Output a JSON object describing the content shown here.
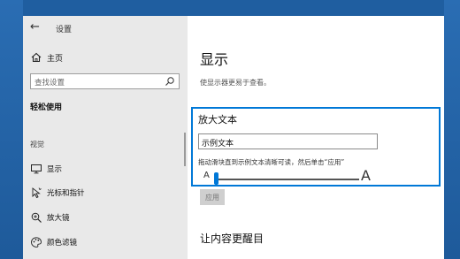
{
  "window": {
    "title": "设置"
  },
  "sidebar": {
    "home_label": "主页",
    "search_placeholder": "查找设置",
    "section_heading": "轻松使用",
    "group_label": "视觉",
    "items": [
      {
        "label": "显示",
        "icon": "monitor-icon",
        "selected": true
      },
      {
        "label": "光标和指针",
        "icon": "cursor-icon",
        "selected": false
      },
      {
        "label": "放大镜",
        "icon": "magnifier-icon",
        "selected": false
      },
      {
        "label": "颜色滤镜",
        "icon": "color-filter-icon",
        "selected": false
      }
    ]
  },
  "main": {
    "title": "显示",
    "description": "使显示器更易于查看。",
    "enlarge_text": {
      "title": "放大文本",
      "sample_text": "示例文本",
      "instruction": "拖动滑块直到示例文本清晰可读，然后单击“应用”",
      "slider_min_label": "A",
      "slider_max_label": "A",
      "slider_value_fraction": 0.0
    },
    "apply_label": "应用",
    "next_section_title": "让内容更醒目"
  },
  "colors": {
    "accent": "#0078d7",
    "desktop": "#1f5ea0",
    "sidebar_bg": "#e9e9e9"
  }
}
